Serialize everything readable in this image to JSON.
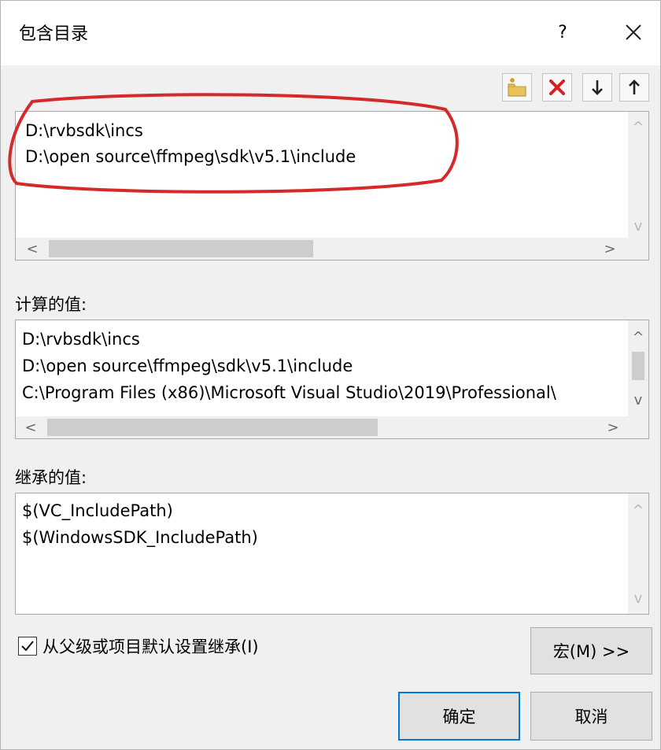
{
  "window": {
    "title": "包含目录",
    "help_label": "?",
    "close_icon": "close-icon"
  },
  "toolbar": {
    "buttons": [
      {
        "name": "new-line-button",
        "icon": "new-folder-icon"
      },
      {
        "name": "delete-button",
        "icon": "delete-x-icon"
      },
      {
        "name": "move-down-button",
        "icon": "arrow-down-icon"
      },
      {
        "name": "move-up-button",
        "icon": "arrow-up-icon"
      }
    ]
  },
  "edit_list": {
    "lines": [
      "D:\\rvbsdk\\incs",
      "D:\\open source\\ffmpeg\\sdk\\v5.1\\include"
    ]
  },
  "computed": {
    "label": "计算的值:",
    "lines": [
      "D:\\rvbsdk\\incs",
      "D:\\open source\\ffmpeg\\sdk\\v5.1\\include",
      "C:\\Program Files (x86)\\Microsoft Visual Studio\\2019\\Professional\\"
    ]
  },
  "inherited": {
    "label": "继承的值:",
    "lines": [
      "$(VC_IncludePath)",
      "$(WindowsSDK_IncludePath)"
    ]
  },
  "inherit_checkbox": {
    "label": "从父级或项目默认设置继承(I)",
    "checked": true
  },
  "buttons": {
    "macros": "宏(M) >>",
    "ok": "确定",
    "cancel": "取消"
  },
  "arrows": {
    "left": "<",
    "right": ">",
    "up": "^",
    "down": "v"
  },
  "colors": {
    "annotation": "#d42a2a",
    "default_button_border": "#0078d7",
    "delete_icon": "#d42020"
  }
}
